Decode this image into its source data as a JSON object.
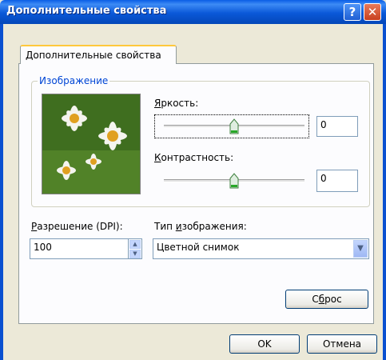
{
  "window": {
    "title": "Дополнительные свойства",
    "help_glyph": "?",
    "close_glyph": "✕"
  },
  "tab": {
    "label": "Дополнительные свойства"
  },
  "image_group": {
    "title": "Изображение",
    "brightness": {
      "label_accel": "Я",
      "label_rest": "ркость:",
      "value": "0",
      "level": 0.5
    },
    "contrast": {
      "label_accel": "К",
      "label_rest": "онтрастность:",
      "value": "0",
      "level": 0.5
    }
  },
  "resolution": {
    "label_accel": "Р",
    "label_rest": "азрешение (DPI):",
    "value": "100"
  },
  "image_type": {
    "label_pre": "Тип ",
    "label_accel": "и",
    "label_rest": "зображения:",
    "selected": "Цветной снимок"
  },
  "buttons": {
    "reset_pre": "С",
    "reset_accel": "б",
    "reset_rest": "рос",
    "ok": "OK",
    "cancel": "Отмена"
  },
  "icons": [
    "help-icon",
    "close-icon",
    "spin-up-icon",
    "spin-down-icon",
    "dropdown-arrow-icon",
    "slider-thumb-icon"
  ],
  "colors": {
    "titlebar": "#0a58d8",
    "group_title": "#0046d5",
    "tab_highlight": "#ffc83c",
    "close_button": "#c8401f"
  }
}
